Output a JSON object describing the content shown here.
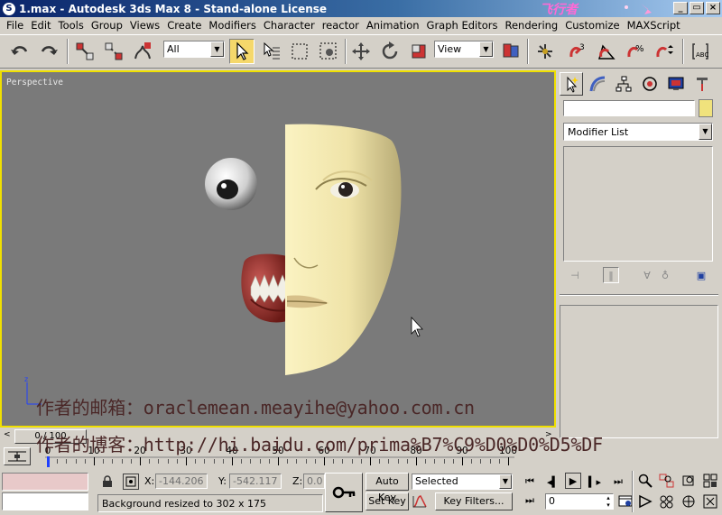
{
  "window": {
    "title": "1.max - Autodesk 3ds Max 8  - Stand-alone License",
    "minimize_glyph": "_",
    "restore_glyph": "▭",
    "close_glyph": "×"
  },
  "menu": [
    "File",
    "Edit",
    "Tools",
    "Group",
    "Views",
    "Create",
    "Modifiers",
    "Character",
    "reactor",
    "Animation",
    "Graph Editors",
    "Rendering",
    "Customize",
    "MAXScript"
  ],
  "toolbar": {
    "selection_filter": "All",
    "reference_coord": "View"
  },
  "viewport": {
    "label": "Perspective",
    "axis_label": "z",
    "overlay_line1": "作者的邮箱：oraclemean.meayihe@yahoo.com.cn",
    "overlay_line2": "作者的博客：http://hi.baidu.com/prima%B7%C9%D0%D0%D5%DF",
    "background": "#7a7a7a",
    "border_color": "#f0e000"
  },
  "command_panel": {
    "modifier_list": "Modifier List"
  },
  "time_slider": {
    "prev": "<",
    "thumb": "0 / 100",
    "next": ">"
  },
  "trackbar": {
    "ticks": [
      "0",
      "10",
      "20",
      "30",
      "40",
      "50",
      "60",
      "70",
      "80",
      "90",
      "100"
    ]
  },
  "status": {
    "x_label": "X:",
    "x_value": "-144.206",
    "y_label": "Y:",
    "y_value": "-542.117",
    "z_label": "Z:",
    "z_value": "0.0",
    "prompt": "Background resized to 302 x 175",
    "auto_key": "Auto Key",
    "set_key": "Set Key",
    "selected": "Selected",
    "key_filters": "Key Filters...",
    "frame": "0"
  }
}
